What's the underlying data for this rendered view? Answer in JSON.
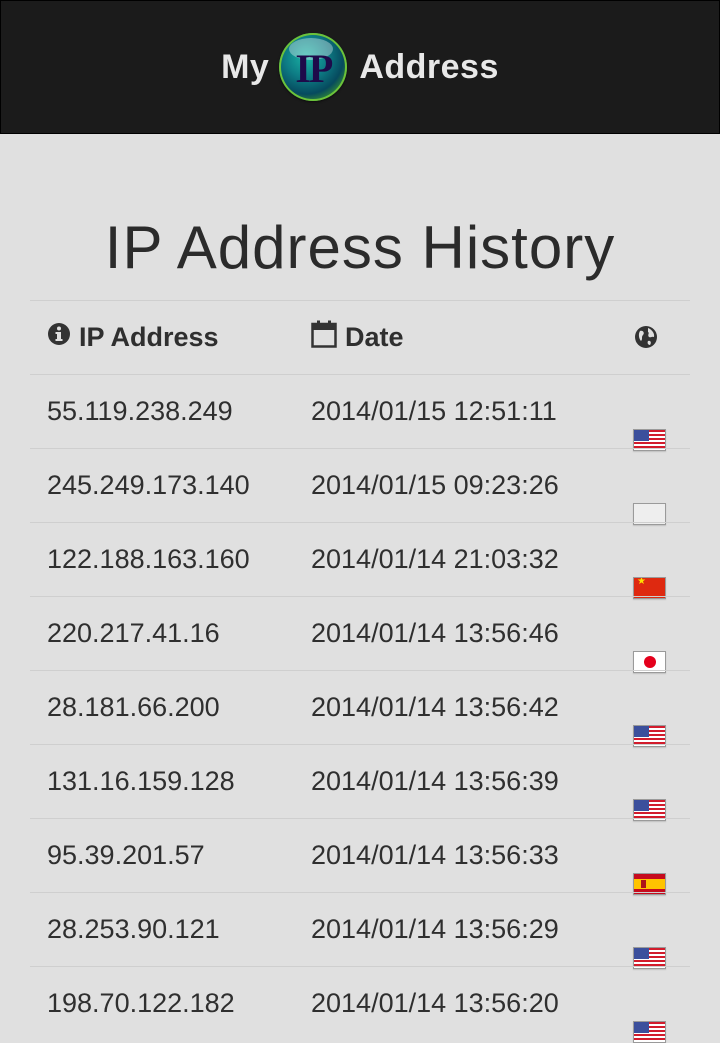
{
  "header": {
    "brand_left": "My",
    "logo_text": "IP",
    "brand_right": "Address"
  },
  "page_title": "IP Address History",
  "table": {
    "columns": {
      "ip": "IP Address",
      "date": "Date",
      "country_icon": "globe-icon"
    },
    "rows": [
      {
        "ip": "55.119.238.249",
        "date": "2014/01/15 12:51:11",
        "flag": "us"
      },
      {
        "ip": "245.249.173.140",
        "date": "2014/01/15 09:23:26",
        "flag": "none"
      },
      {
        "ip": "122.188.163.160",
        "date": "2014/01/14 21:03:32",
        "flag": "cn"
      },
      {
        "ip": "220.217.41.16",
        "date": "2014/01/14 13:56:46",
        "flag": "jp"
      },
      {
        "ip": "28.181.66.200",
        "date": "2014/01/14 13:56:42",
        "flag": "us"
      },
      {
        "ip": "131.16.159.128",
        "date": "2014/01/14 13:56:39",
        "flag": "us"
      },
      {
        "ip": "95.39.201.57",
        "date": "2014/01/14 13:56:33",
        "flag": "es"
      },
      {
        "ip": "28.253.90.121",
        "date": "2014/01/14 13:56:29",
        "flag": "us"
      },
      {
        "ip": "198.70.122.182",
        "date": "2014/01/14 13:56:20",
        "flag": "us"
      }
    ]
  },
  "colors": {
    "header_bg": "#1b1b1b",
    "page_bg": "#e0e0e0",
    "text": "#2f2f2f",
    "divider": "#cfcfcf"
  }
}
